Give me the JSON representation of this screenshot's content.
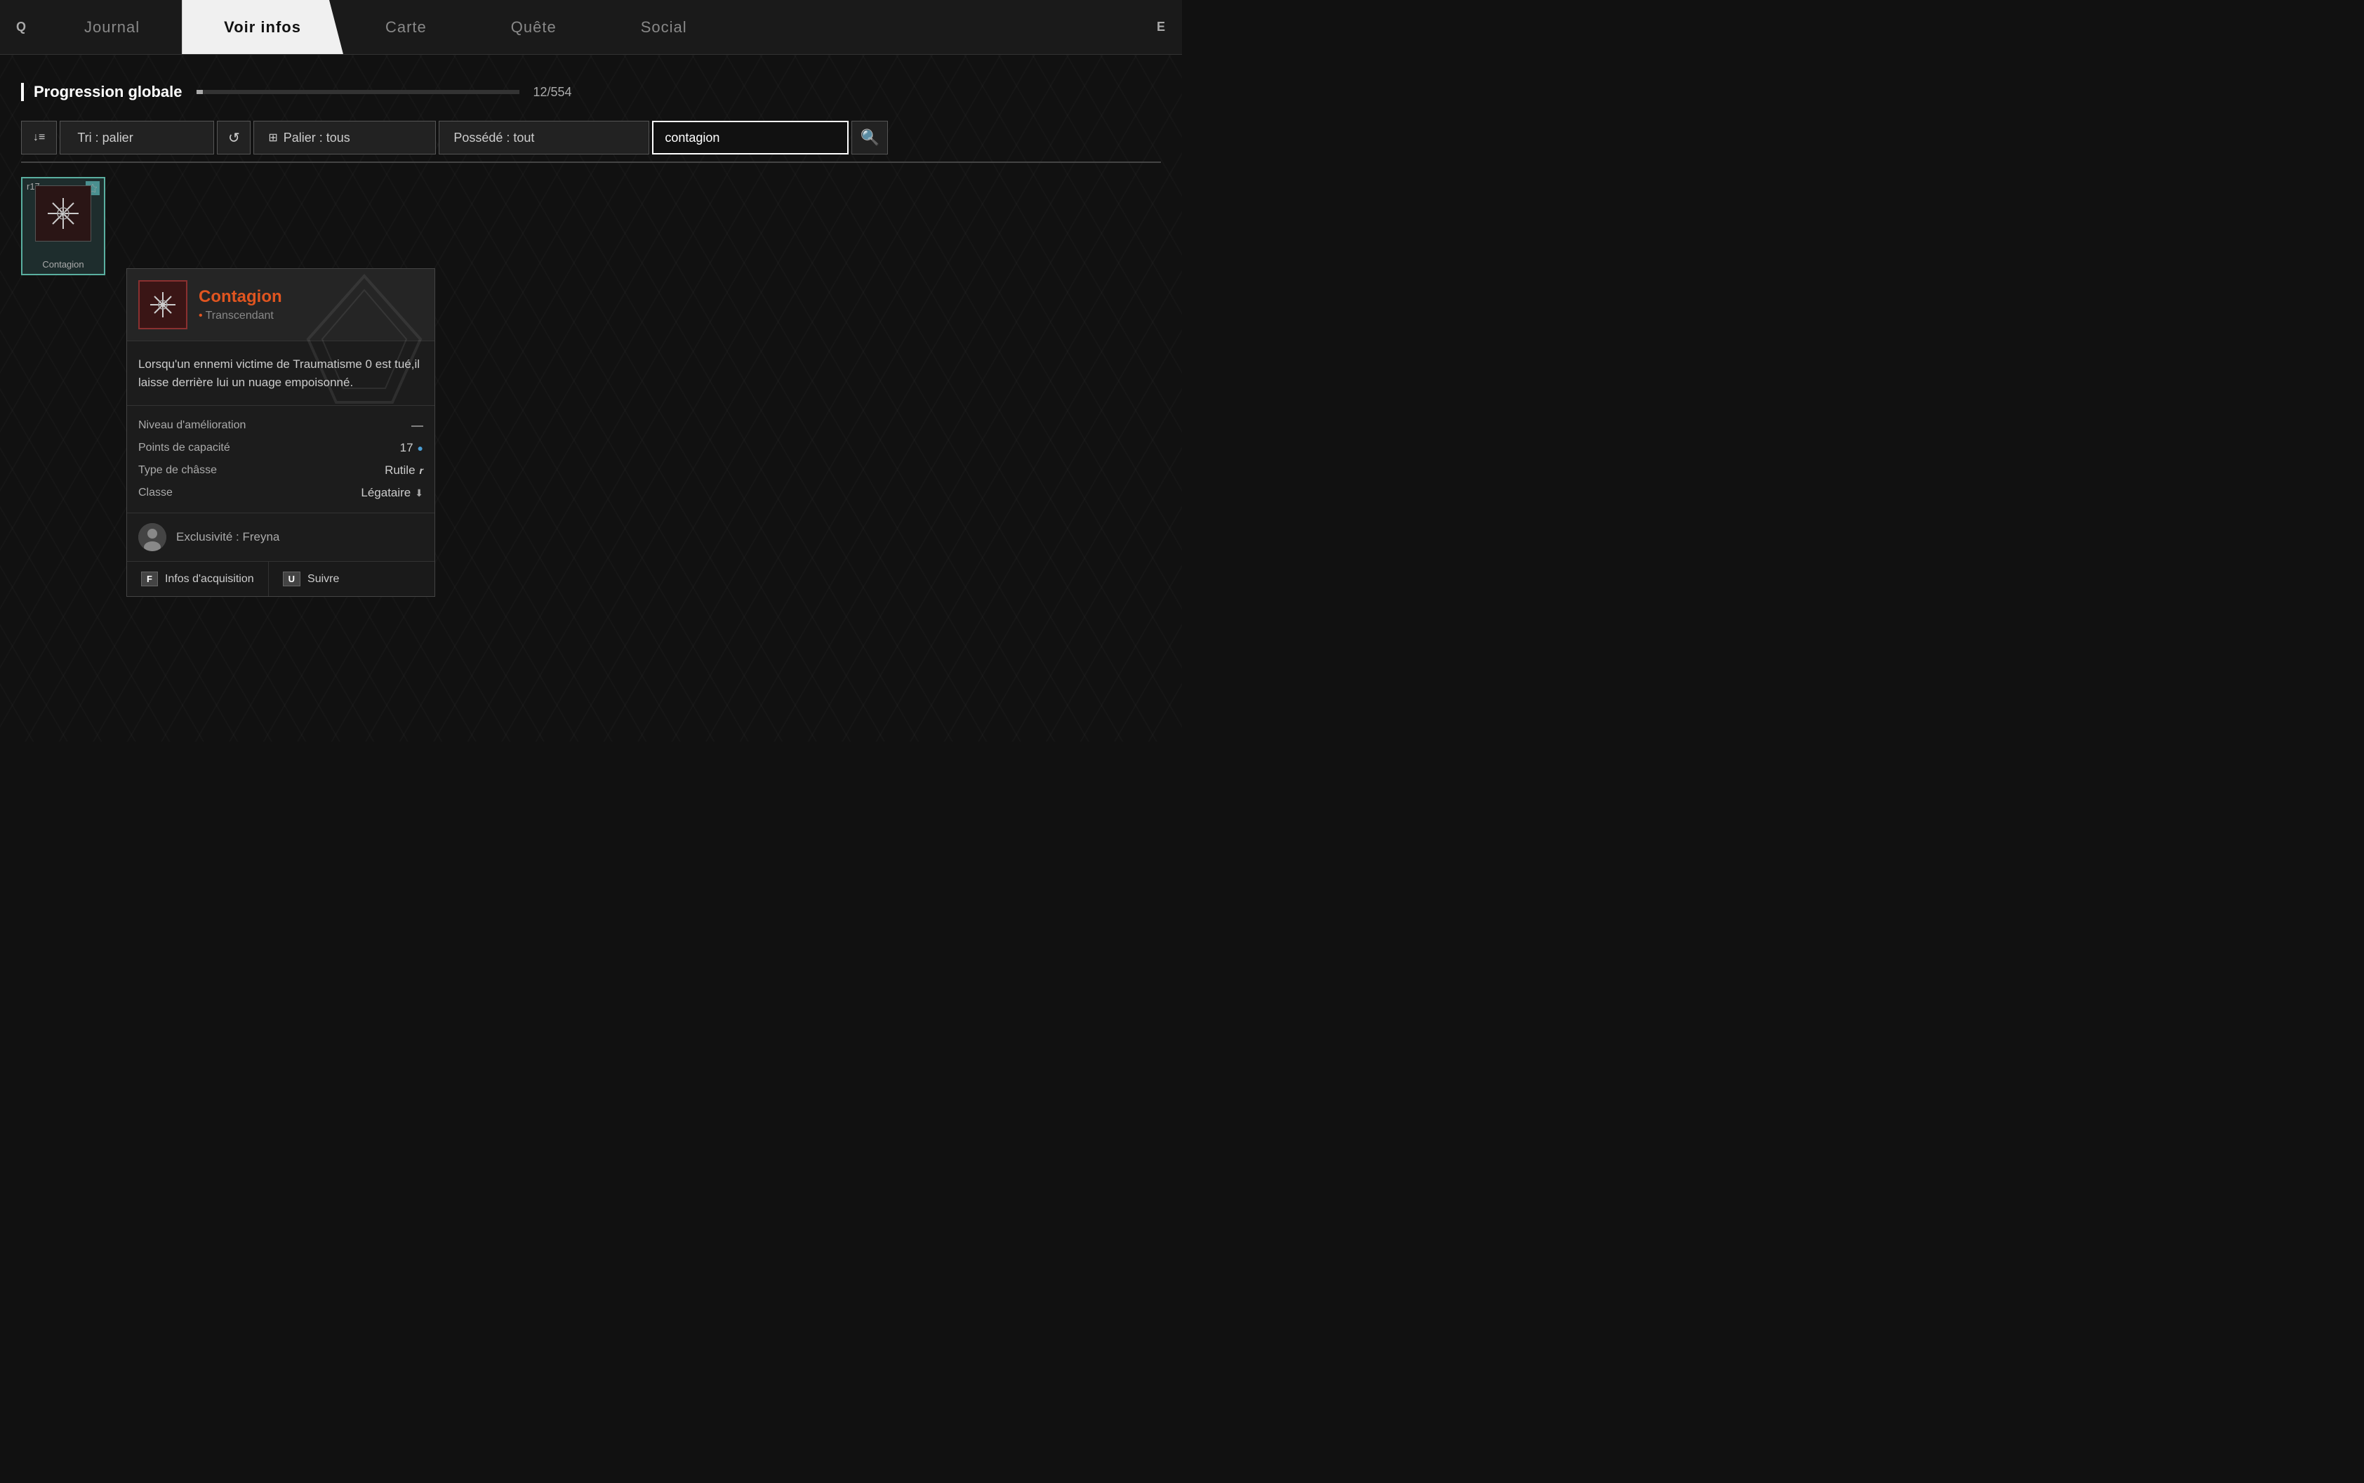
{
  "navbar": {
    "key_left": "Q",
    "key_right": "E",
    "tabs": [
      {
        "id": "journal",
        "label": "Journal",
        "active": false
      },
      {
        "id": "voir-infos",
        "label": "Voir infos",
        "active": true
      },
      {
        "id": "carte",
        "label": "Carte",
        "active": false
      },
      {
        "id": "quete",
        "label": "Quête",
        "active": false
      },
      {
        "id": "social",
        "label": "Social",
        "active": false
      }
    ]
  },
  "progress": {
    "label": "Progression globale",
    "current": "12",
    "total": "554",
    "display": "12/554",
    "fill_pct": "2.17"
  },
  "filters": {
    "sort_label": "Tri : palier",
    "palier_label": "Palier : tous",
    "possede_label": "Possédé : tout",
    "search_value": "contagion",
    "search_placeholder": "contagion"
  },
  "item": {
    "name": "Contagion",
    "level": "r17",
    "label": "Contagion"
  },
  "tooltip": {
    "title": "Contagion",
    "subtitle": "Transcendant",
    "description": "Lorsqu'un ennemi victime de Traumatisme 0 est tué,il laisse derrière lui un nuage empoisonné.",
    "stats": [
      {
        "label": "Niveau d'amélioration",
        "value": "—",
        "icon": ""
      },
      {
        "label": "Points de capacité",
        "value": "17",
        "icon": "drop"
      },
      {
        "label": "Type de châsse",
        "value": "Rutile",
        "icon": "rutile"
      },
      {
        "label": "Classe",
        "value": "Légataire",
        "icon": "class"
      }
    ],
    "exclusivity": "Exclusivité : Freyna",
    "actions": [
      {
        "key": "F",
        "label": "Infos d'acquisition"
      },
      {
        "key": "U",
        "label": "Suivre"
      }
    ]
  },
  "icons": {
    "sort": "↓≡",
    "reset": "↺",
    "layers": "⊞",
    "search": "🔍",
    "contagion_glyph": "✦",
    "drop": "💧",
    "class_arrow": "⬇"
  }
}
